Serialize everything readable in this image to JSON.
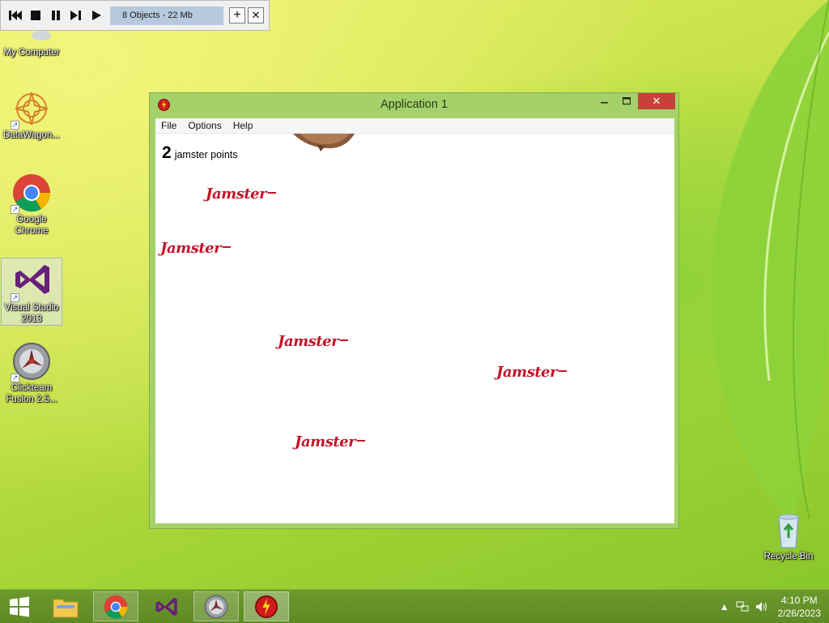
{
  "toolbar": {
    "status": "8 Objects - 22 Mb",
    "buttons": [
      "restart-icon",
      "stop-icon",
      "pause-icon",
      "step-icon",
      "play-icon"
    ],
    "plus": "+",
    "close": "✕"
  },
  "desktop": {
    "icons": [
      {
        "label": "My Computer"
      },
      {
        "label": "DataWagon..."
      },
      {
        "label": "Google Chrome"
      },
      {
        "label": "Visual Studio 2013"
      },
      {
        "label": "Clickteam Fusion 2.5..."
      },
      {
        "label": "Recycle Bin"
      }
    ]
  },
  "window": {
    "title": "Application 1",
    "menu": [
      "File",
      "Options",
      "Help"
    ],
    "close_glyph": "✕",
    "score_value": "2",
    "score_label": "jamster points",
    "jamster_text": "Jamster"
  },
  "taskbar": {
    "time": "4:10 PM",
    "date": "2/26/2023"
  },
  "colors": {
    "window_border": "#a4d16a",
    "close_button": "#c7403a",
    "jamster_red": "#c4142a",
    "taskbar": "#5e8a24"
  }
}
